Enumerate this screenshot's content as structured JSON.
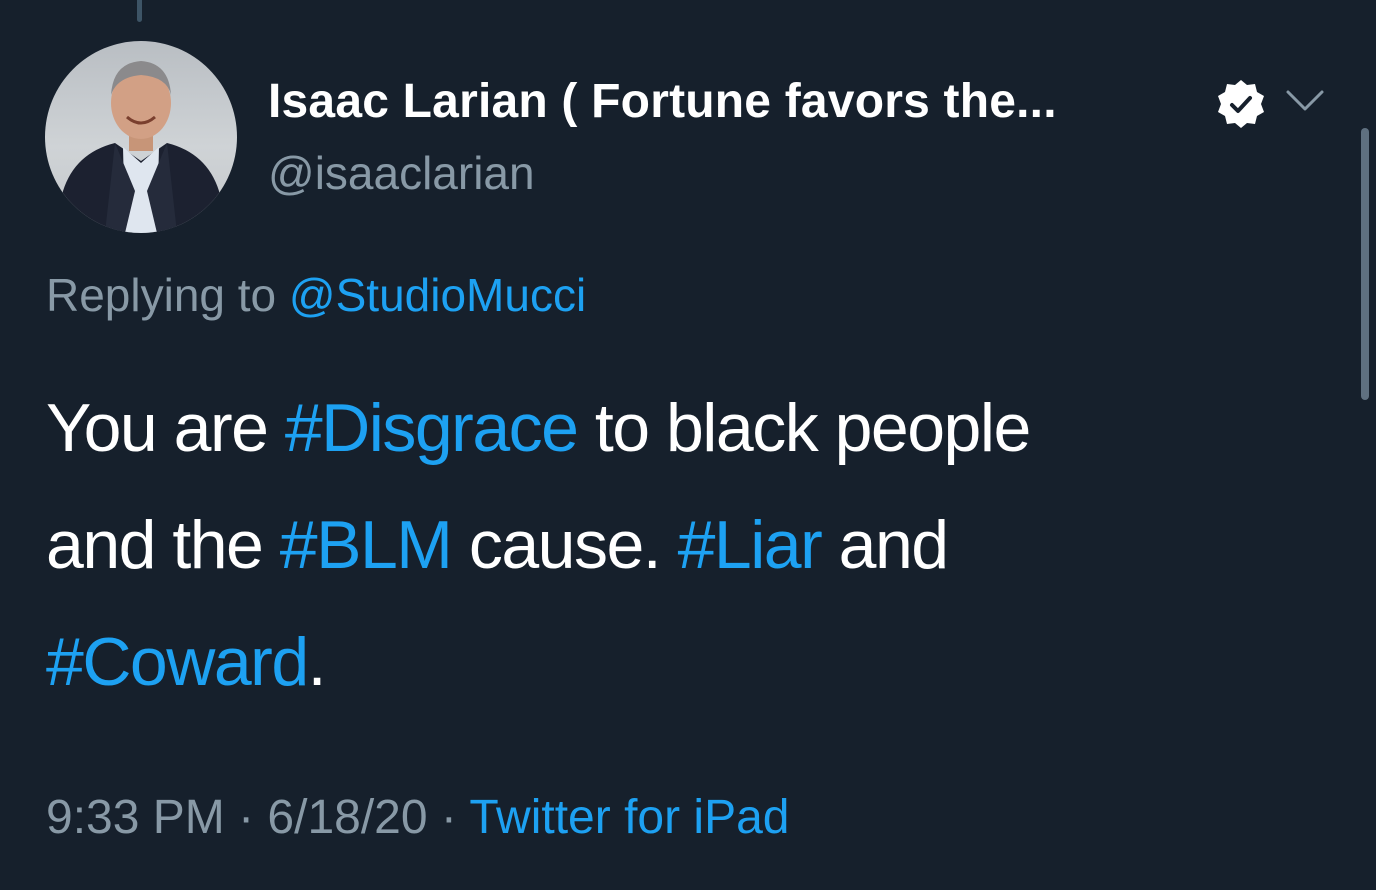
{
  "tweet": {
    "display_name": "Isaac Larian ( Fortune favors the...",
    "handle": "@isaaclarian",
    "verified_icon": "verified-badge-icon",
    "menu_icon": "chevron-down-icon",
    "replying_prefix": "Replying to",
    "replying_to": "@StudioMucci",
    "text": {
      "line1": {
        "part1": "You are ",
        "hashtag1": "#Disgrace",
        "part2": " to black people"
      },
      "line2": {
        "part1": "and the ",
        "hashtag2": "#BLM",
        "part2": " cause. ",
        "hashtag3": "#Liar",
        "part3": " and"
      },
      "line3": {
        "hashtag4": "#Coward",
        "part1": "."
      }
    },
    "time": "9:33 PM",
    "separator1": " · ",
    "date": "6/18/20",
    "separator2": " · ",
    "source": "Twitter for iPad"
  },
  "colors": {
    "background": "#16202c",
    "text_primary": "#ffffff",
    "text_secondary": "#8899a6",
    "accent": "#1da1f2"
  }
}
